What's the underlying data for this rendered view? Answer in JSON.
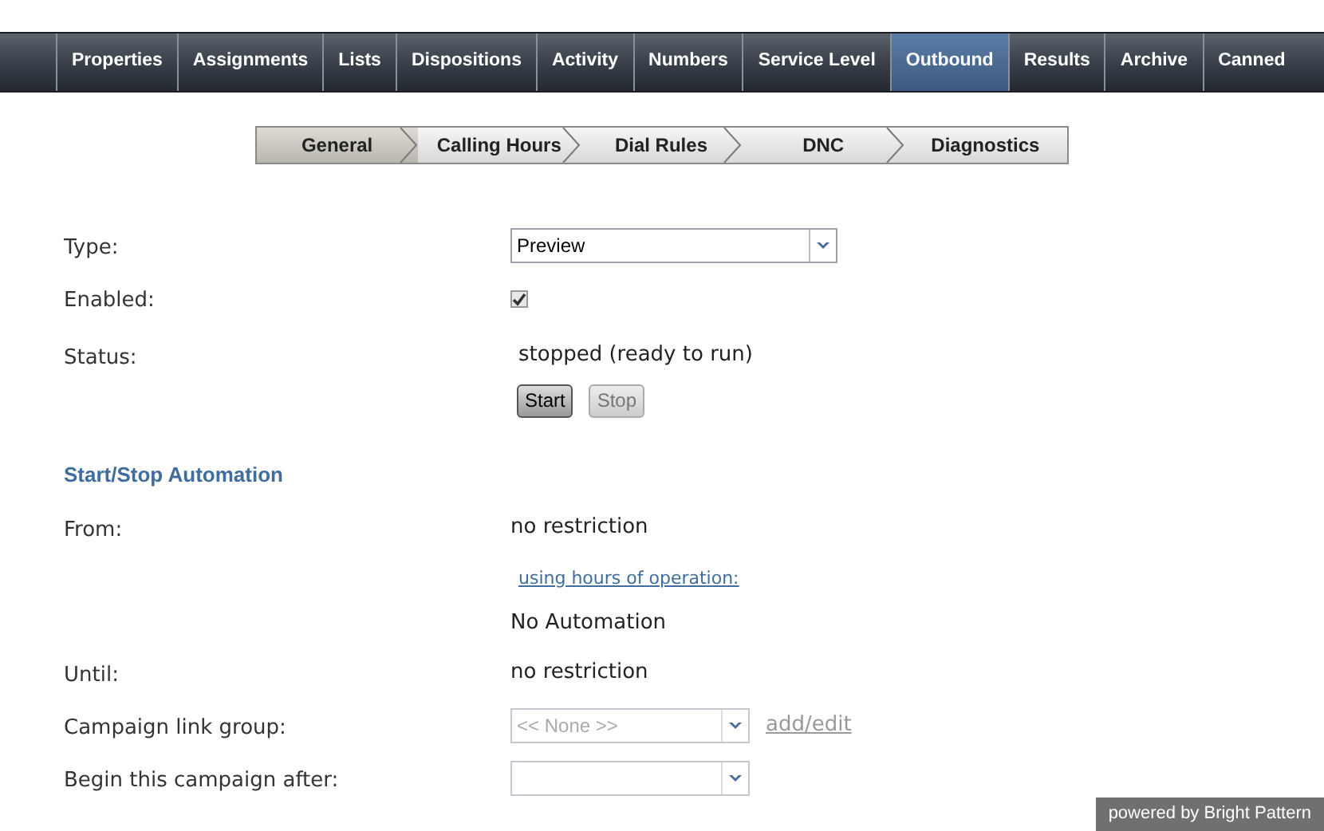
{
  "nav_tabs": [
    {
      "label": "Properties",
      "selected": false
    },
    {
      "label": "Assignments",
      "selected": false
    },
    {
      "label": "Lists",
      "selected": false
    },
    {
      "label": "Dispositions",
      "selected": false
    },
    {
      "label": "Activity",
      "selected": false
    },
    {
      "label": "Numbers",
      "selected": false
    },
    {
      "label": "Service Level",
      "selected": false
    },
    {
      "label": "Outbound",
      "selected": true
    },
    {
      "label": "Results",
      "selected": false
    },
    {
      "label": "Archive",
      "selected": false
    },
    {
      "label": "Canned",
      "selected": false
    }
  ],
  "sub_tabs": [
    {
      "label": "General",
      "selected": true
    },
    {
      "label": "Calling Hours",
      "selected": false
    },
    {
      "label": "Dial Rules",
      "selected": false
    },
    {
      "label": "DNC",
      "selected": false
    },
    {
      "label": "Diagnostics",
      "selected": false
    }
  ],
  "rows": [
    {
      "kind": "select",
      "label": "Type:",
      "value": "Preview",
      "disabled": false
    },
    {
      "kind": "checkbox",
      "label": "Enabled:",
      "checked": true
    },
    {
      "kind": "text",
      "label": "Status:",
      "value": "stopped (ready to run)"
    },
    {
      "kind": "buttons",
      "buttons": [
        {
          "label": "Start",
          "disabled": false
        },
        {
          "label": "Stop",
          "disabled": true
        }
      ]
    },
    {
      "kind": "heading",
      "label": "Start/Stop Automation"
    },
    {
      "kind": "text",
      "label": "From:",
      "value": "no restriction"
    },
    {
      "kind": "link",
      "value": "using hours of operation:"
    },
    {
      "kind": "text",
      "value": "No Automation"
    },
    {
      "kind": "text",
      "label": "Until:",
      "value": "no restriction"
    },
    {
      "kind": "select",
      "label": "Campaign link group:",
      "value": "<< None >>",
      "disabled": true,
      "link": {
        "label": "add/edit",
        "disabled": true
      }
    },
    {
      "kind": "select",
      "label": "Begin this campaign after:",
      "disabled": true
    }
  ],
  "footer": "powered by Bright Pattern"
}
